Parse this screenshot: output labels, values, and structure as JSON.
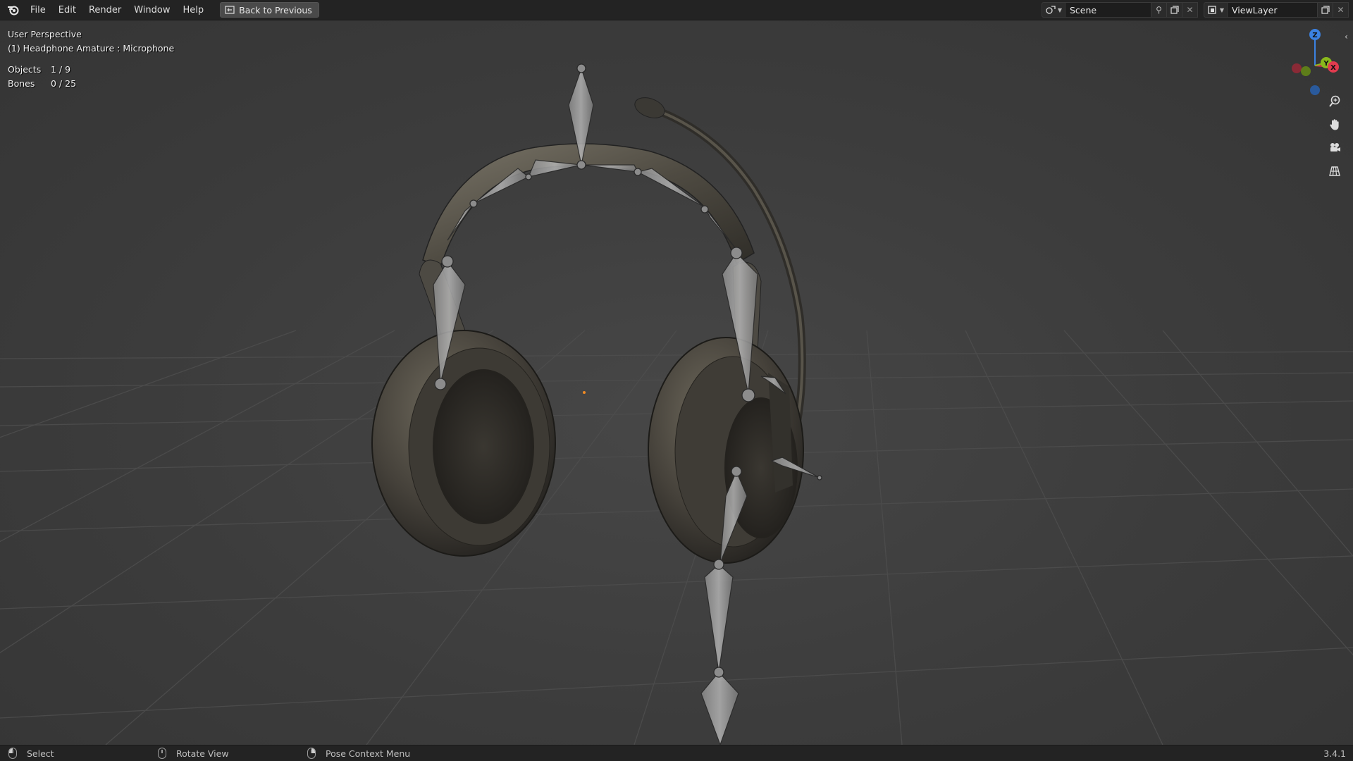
{
  "menu": {
    "items": [
      "File",
      "Edit",
      "Render",
      "Window",
      "Help"
    ],
    "back_button": "Back to Previous"
  },
  "scene": {
    "name": "Scene"
  },
  "view_layer": {
    "name": "ViewLayer"
  },
  "viewport": {
    "view_name": "User Perspective",
    "active_object": "(1) Headphone Amature : Microphone",
    "stats": {
      "objects_label": "Objects",
      "objects_value": "1 / 9",
      "bones_label": "Bones",
      "bones_value": "0 / 25"
    },
    "gizmo": {
      "x": "X",
      "y": "Y",
      "z": "Z"
    },
    "nav_icons": [
      "zoom-icon",
      "hand-pan-icon",
      "camera-icon",
      "grid-ortho-icon"
    ]
  },
  "statusbar": {
    "select": "Select",
    "rotate": "Rotate View",
    "context": "Pose Context Menu",
    "version": "3.4.1"
  },
  "colors": {
    "axis_x": "#e23b4f",
    "axis_y": "#8ab81c",
    "axis_z": "#3b82e2",
    "bone": "#9c9c9c"
  }
}
